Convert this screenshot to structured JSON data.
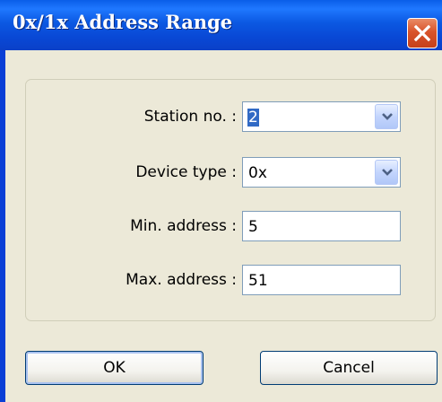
{
  "window": {
    "title": "0x/1x Address Range"
  },
  "form": {
    "station": {
      "label": "Station no. :",
      "value": "2"
    },
    "device_type": {
      "label": "Device type :",
      "value": "0x"
    },
    "min_address": {
      "label": "Min. address :",
      "value": "5"
    },
    "max_address": {
      "label": "Max. address :",
      "value": "51"
    }
  },
  "buttons": {
    "ok": "OK",
    "cancel": "Cancel"
  },
  "icons": {
    "close": "close-icon",
    "dropdown": "chevron-down-icon"
  },
  "colors": {
    "titlebar": "#0a58e2",
    "close_button": "#d9542b",
    "client_background": "#ece9d8",
    "selection": "#316ac5"
  }
}
